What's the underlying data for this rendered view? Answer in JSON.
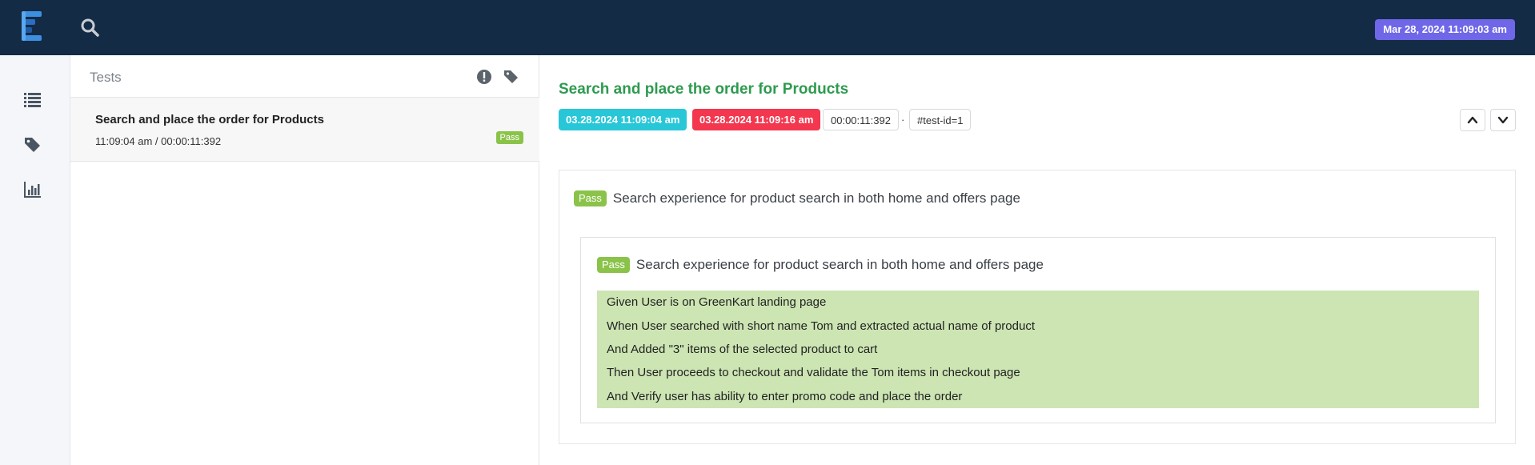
{
  "header": {
    "logo_icon": "extent-reports-logo-icon",
    "search_icon": "search-icon",
    "datetime": "Mar 28, 2024 11:09:03 am",
    "datetime_color": "#6f67e8"
  },
  "sidenav": {
    "items": [
      {
        "icon": "list-icon"
      },
      {
        "icon": "tag-icon"
      },
      {
        "icon": "bar-chart-icon"
      }
    ]
  },
  "tests": {
    "title": "Tests",
    "header_icons": [
      "exclamation-circle-icon",
      "tag-icon"
    ],
    "items": [
      {
        "name": "Search and place the order for Products",
        "meta": "11:09:04 am / 00:00:11:392",
        "status": "Pass"
      }
    ]
  },
  "detail": {
    "title": "Search and place the order for Products",
    "start": "03.28.2024 11:09:04 am",
    "end": "03.28.2024 11:09:16 am",
    "duration": "00:00:11:392",
    "separator": "·",
    "test_id": "#test-id=1",
    "nav_icons": [
      "chevron-up-icon",
      "chevron-down-icon"
    ],
    "feature": {
      "status": "Pass",
      "name": "Search experience for product search in both home and offers page",
      "scenario": {
        "status": "Pass",
        "name": "Search experience for product search in both home and offers page",
        "steps": [
          "Given User is on GreenKart landing page",
          "When User searched with short name Tom and extracted actual name of product",
          "And Added \"3\" items of the selected product to cart",
          "Then User proceeds to checkout and validate the Tom items in checkout page",
          "And Verify user has ability to enter promo code and place the order"
        ]
      }
    },
    "colors": {
      "title": "#2e9b4f",
      "start_chip": "#27c7d8",
      "end_chip": "#f3374f",
      "pass": "#8bc34a",
      "steps_bg": "#cce5b3"
    }
  }
}
